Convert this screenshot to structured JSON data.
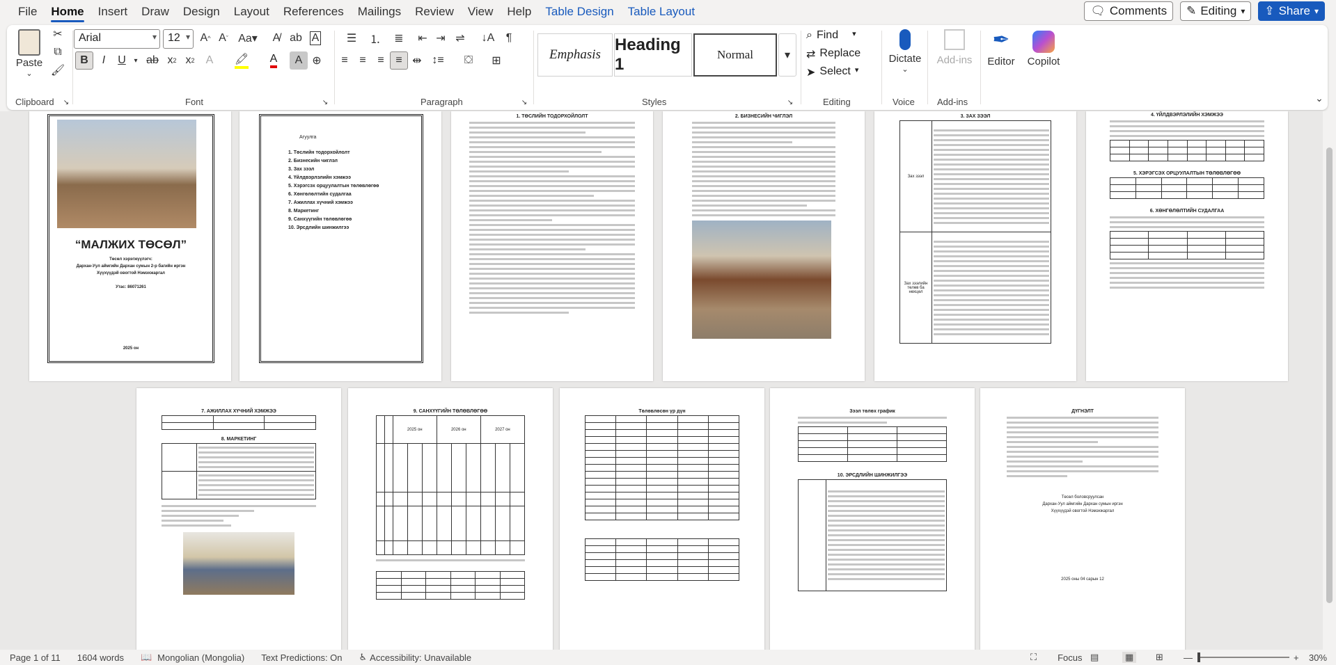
{
  "menu": {
    "tabs": [
      "File",
      "Home",
      "Insert",
      "Draw",
      "Design",
      "Layout",
      "References",
      "Mailings",
      "Review",
      "View",
      "Help",
      "Table Design",
      "Table Layout"
    ],
    "comments": "Comments",
    "editing": "Editing",
    "share": "Share"
  },
  "ribbon": {
    "clipboard": {
      "paste": "Paste",
      "label": "Clipboard"
    },
    "font": {
      "name": "Arial",
      "size": "12",
      "label": "Font"
    },
    "paragraph": {
      "label": "Paragraph"
    },
    "styles": {
      "label": "Styles",
      "items": [
        "Emphasis",
        "Heading 1",
        "Normal"
      ]
    },
    "editing": {
      "find": "Find",
      "replace": "Replace",
      "select": "Select",
      "label": "Editing"
    },
    "voice": {
      "dictate": "Dictate",
      "label": "Voice"
    },
    "addins": {
      "addins": "Add-ins",
      "label": "Add-ins"
    },
    "editor": "Editor",
    "copilot": "Copilot"
  },
  "doc": {
    "cover": {
      "title": "“МАЛЖИХ ТӨСӨЛ”",
      "l1": "Төсөл хэрэгжүүлэгч:",
      "l2": "Дархан-Уул аймгийн Дархан сумын 2-р багийн иргэн",
      "l3": "Хүүхүүдэй овогтой Нэмэхжаргал",
      "phone": "Утас: 86071261",
      "year": "2025 он"
    },
    "toc": {
      "head": "Агуулга",
      "items": [
        "1. Төслийн тодорхойлолт",
        "2. Бизнесийн чиглэл",
        "3. Зах зээл",
        "4. Үйлдвэрлэлийн хэмжээ",
        "5. Хэрэгсэх орцуулалтын төлөвлөгөө",
        "6. Хөнгөлөлтийн судалгаа",
        "7. Ажиллах хүчний хэмжээ",
        "8. Маркетинг",
        "9. Санхүүгийн төлөвлөгөө",
        "10. Эрсдлийн шинжилгээ"
      ]
    },
    "p3": {
      "title": "1. ТӨСЛИЙН ТОДОРХОЙЛОЛТ"
    },
    "p4": {
      "title": "2. БИЗНЕСИЙН ЧИГЛЭЛ"
    },
    "p5": {
      "title": "3. ЗАХ ЗЭЭЛ",
      "cell1": "Зах зээл",
      "cell2": "Зах зээлийн төлөв ба нөхцөл"
    },
    "p6": {
      "title": "4. ҮЙЛДВЭРЛЭЛИЙН ХЭМЖЭЭ",
      "sub": "5. ХЭРЭГСЭХ ОРЦУУЛАЛТЫН ТӨЛӨВЛӨГӨӨ",
      "sub2": "6. ХӨНГӨЛӨЛТИЙН СУДАЛГАА"
    },
    "p7": {
      "title": "7. АЖИЛЛАХ ХҮЧНИЙ ХЭМЖЭЭ",
      "sub": "8. МАРКЕТИНГ"
    },
    "p8": {
      "title": "9. САНХҮҮГИЙН ТӨЛӨВЛӨГӨӨ",
      "y1": "2025 он",
      "y2": "2026 он",
      "y3": "2027 он"
    },
    "p9": {
      "title": "Төлөвлөсөн үр дүн"
    },
    "p10": {
      "title": "Зээл төлөх график",
      "sub": "10. ЭРСДЛИЙН ШИНЖИЛГЭЭ"
    },
    "p11": {
      "title": "ДҮГНЭЛТ",
      "sign1": "Төсөл боловсруулсан",
      "sign2": "Дархан-Уул аймгийн Дархан сумын иргэн",
      "sign3": "Хүүхүүдэй овогтой Нэмэхжаргал",
      "date": "2025 оны 04 сарын 12"
    }
  },
  "status": {
    "page": "Page 1 of 11",
    "words": "1604 words",
    "lang": "Mongolian (Mongolia)",
    "pred": "Text Predictions: On",
    "access": "Accessibility: Unavailable",
    "focus": "Focus",
    "zoom": "30%"
  }
}
